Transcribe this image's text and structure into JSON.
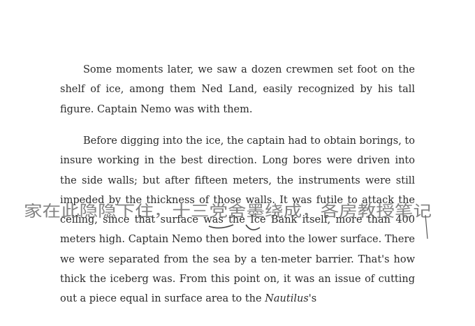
{
  "document": {
    "paragraphs": [
      {
        "text": "Some moments later, we saw a dozen crewmen set foot on the shelf of ice, among them Ned Land, easily recognized by his tall figure. Captain Nemo was with them."
      },
      {
        "text_before_italic": "Before digging into the ice, the captain had to obtain borings, to insure working in the best direction. Long bores were driven into the side walls; but after fifteen meters, the instruments were still impeded by the thickness of those walls. It was futile to attack the ceiling, since that surface was the Ice Bank itself, more than 400 meters high. Captain Nemo then bored into the lower surface. There we were separated from the sea by a ten-meter barrier. That's how thick the iceberg was. From this point on, it was an issue of cutting out a piece equal in surface area to the ",
        "italic": "Nautilus",
        "text_after_italic": "'s"
      }
    ],
    "handwritten_annotation": "家在此隐隐下住，十三党舍墨绕成，各房教授笔记"
  },
  "colors": {
    "text": "#2a2a2a",
    "ink": "#555555",
    "background": "#ffffff"
  }
}
